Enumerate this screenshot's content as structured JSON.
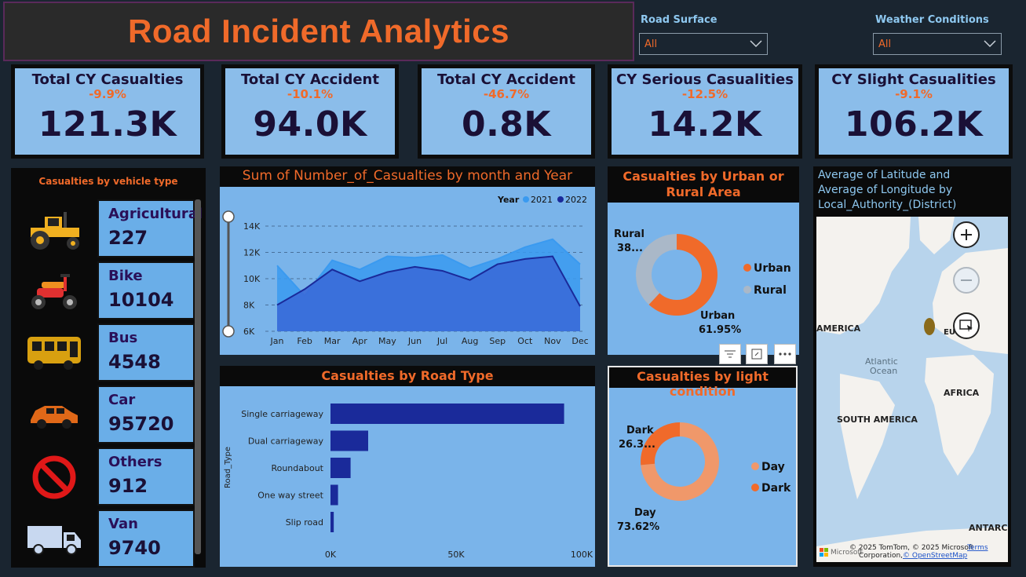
{
  "title": "Road Incident Analytics",
  "filters": {
    "road_surface": {
      "label": "Road Surface",
      "value": "All"
    },
    "weather": {
      "label": "Weather Conditions",
      "value": "All"
    }
  },
  "kpis": [
    {
      "title": "Total CY Casualties",
      "change": "-9.9%",
      "value": "121.3K"
    },
    {
      "title": "Total CY Accident",
      "change": "-10.1%",
      "value": "94.0K"
    },
    {
      "title": "Total CY Accident",
      "change": "-46.7%",
      "value": "0.8K"
    },
    {
      "title": "CY Serious Casualities",
      "change": "-12.5%",
      "value": "14.2K"
    },
    {
      "title": "CY Slight Casualities",
      "change": "-9.1%",
      "value": "106.2K"
    }
  ],
  "vehicles": {
    "title": "Casualties by vehicle type",
    "items": [
      {
        "name": "Agricultural",
        "value": "227",
        "icon": "tractor-icon"
      },
      {
        "name": "Bike",
        "value": "10104",
        "icon": "motorbike-icon"
      },
      {
        "name": "Bus",
        "value": "4548",
        "icon": "bus-icon"
      },
      {
        "name": "Car",
        "value": "95720",
        "icon": "car-icon"
      },
      {
        "name": "Others",
        "value": "912",
        "icon": "no-entry-icon"
      },
      {
        "name": "Van",
        "value": "9740",
        "icon": "van-icon"
      }
    ]
  },
  "area_chart": {
    "title": "Sum of Number_of_Casualties by month and Year",
    "legend_label": "Year",
    "series_colors": [
      "#3a9af0",
      "#1a2a9a"
    ],
    "chart_data": {
      "type": "area",
      "categories": [
        "Jan",
        "Feb",
        "Mar",
        "Apr",
        "May",
        "Jun",
        "Jul",
        "Aug",
        "Sep",
        "Oct",
        "Nov",
        "Dec"
      ],
      "series": [
        {
          "name": "2021",
          "values": [
            11000,
            8700,
            11400,
            10700,
            11700,
            11600,
            11800,
            10800,
            11500,
            12400,
            13000,
            11100
          ]
        },
        {
          "name": "2022",
          "values": [
            8000,
            9200,
            10700,
            9800,
            10500,
            10900,
            10600,
            9900,
            11100,
            11500,
            11700,
            7900
          ]
        }
      ],
      "y_ticks": [
        "6K",
        "8K",
        "10K",
        "12K",
        "14K"
      ],
      "ylim": [
        6000,
        14000
      ]
    }
  },
  "urban_chart": {
    "title_line1": "Casualties by Urban or",
    "title_line2": "Rural Area",
    "chart_data": {
      "type": "pie",
      "labels": [
        "Urban",
        "Rural"
      ],
      "values": [
        61.95,
        38.05
      ],
      "colors": [
        "#f06a2a",
        "#aab8c8"
      ]
    },
    "label_rural": "Rural",
    "label_rural_val": "38...",
    "label_urban": "Urban",
    "label_urban_val": "61.95%",
    "legend": [
      "Urban",
      "Rural"
    ]
  },
  "road_chart": {
    "title": "Casualties by Road Type",
    "axis_label": "Road_Type",
    "bar_color": "#1a2a9a",
    "chart_data": {
      "type": "bar",
      "categories": [
        "Single carriageway",
        "Dual carriageway",
        "Roundabout",
        "One way street",
        "Slip road"
      ],
      "values": [
        93000,
        15000,
        8000,
        3000,
        1300
      ],
      "x_ticks": [
        "0K",
        "50K",
        "100K"
      ],
      "xlim": [
        0,
        100000
      ]
    }
  },
  "light_chart": {
    "title": "Casualties by light condition",
    "chart_data": {
      "type": "pie",
      "labels": [
        "Day",
        "Dark"
      ],
      "values": [
        73.62,
        26.38
      ],
      "colors": [
        "#f0986a",
        "#f06a2a"
      ]
    },
    "label_dark": "Dark",
    "label_dark_val": "26.3...",
    "label_day": "Day",
    "label_day_val": "73.62%",
    "legend": [
      "Day",
      "Dark"
    ]
  },
  "map": {
    "title_line1": "Average of Latitude and",
    "title_line2": "Average of Longitude by",
    "title_line3": "Local_Authority_(District)",
    "labels": {
      "america": "AMERICA",
      "eu": "EU",
      "atlantic": "Atlantic",
      "ocean": "Ocean",
      "africa": "AFRICA",
      "south_america": "SOUTH AMERICA",
      "antarc": "ANTARC"
    },
    "attribution": "© 2025 TomTom, © 2025 Microsoft",
    "attribution2": "Corporation,",
    "osm": "© OpenStreetMap",
    "terms": "Terms",
    "ms_label": "Microsoft"
  }
}
